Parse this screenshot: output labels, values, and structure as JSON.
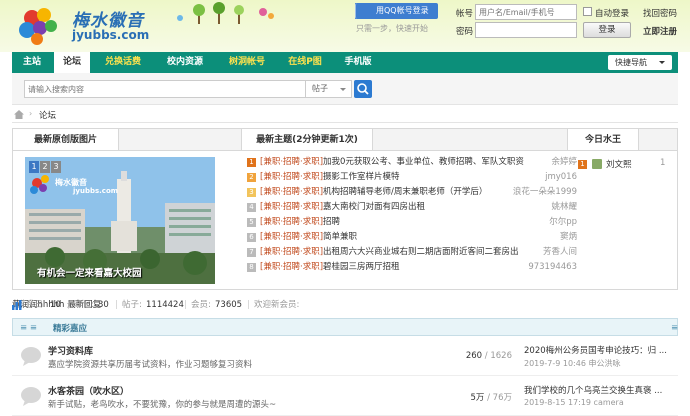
{
  "header": {
    "logo_cn": "梅水徽音",
    "logo_en": "jyubbs.com",
    "qq_login": "用QQ帐号登录",
    "qq_hint": "只需一步，快速开始",
    "account_label": "帐号",
    "account_placeholder": "用户名/Email/手机号",
    "password_label": "密码",
    "auto_login": "自动登录",
    "find_password": "找回密码",
    "login_button": "登录",
    "register": "立即注册"
  },
  "nav": {
    "items": [
      "主站",
      "论坛",
      "兑换话费",
      "校内资源",
      "树洞帐号",
      "在线P图",
      "手机版"
    ],
    "quick_nav": "快捷导航"
  },
  "search": {
    "placeholder": "请输入搜索内容",
    "type": "帖子"
  },
  "breadcrumb": {
    "current": "论坛"
  },
  "portal": {
    "photos_title": "最新原创版图片",
    "slide_nums": [
      "1",
      "2",
      "3"
    ],
    "slide_caption": "有机会一定来看嘉大校园",
    "slide_logo_en": "jyubbs.com",
    "slide_logo_cn": "梅水徽音",
    "threads_title": "最新主题(2分钟更新1次)",
    "threads": [
      {
        "n": "1",
        "tag": "[兼职·招聘·求职]",
        "title": "加我0元获取公考、事业单位、教师招聘、军队文职资",
        "author": "余婷婷"
      },
      {
        "n": "2",
        "tag": "[兼职·招聘·求职]",
        "title": "摄影工作室样片模特",
        "author": "jmy016"
      },
      {
        "n": "3",
        "tag": "[兼职·招聘·求职]",
        "title": "机构招聘辅导老师/周末兼职老师（开学后）",
        "author": "浪花一朵朵1999"
      },
      {
        "n": "4",
        "tag": "[兼职·招聘·求职]",
        "title": "嘉大南校门对面有四房出租",
        "author": "姚林耀"
      },
      {
        "n": "5",
        "tag": "[兼职·招聘·求职]",
        "title": "招聘",
        "author": "尔尔pp"
      },
      {
        "n": "6",
        "tag": "[兼职·招聘·求职]",
        "title": "简单兼职",
        "author": "窦炳"
      },
      {
        "n": "7",
        "tag": "[兼职·招聘·求职]",
        "title": "出租周六大兴商业城右则二期店面附近客间二套房出",
        "author": "芳香人间"
      },
      {
        "n": "8",
        "tag": "[兼职·招聘·求职]",
        "title": "碧桂园三房两厅招租",
        "author": "973194463"
      }
    ],
    "king_title": "今日水王",
    "king": {
      "rank": "1",
      "name": "刘文熙",
      "count": "1"
    }
  },
  "stats": {
    "today_label": "今日:",
    "today": "10",
    "yesterday_label": "昨日:",
    "yesterday": "30",
    "posts_label": "帖子:",
    "posts": "1114424",
    "members_label": "会员:",
    "members": "73605",
    "welcome": "欢迎新会员:",
    "new_member": "黄润润hhhhh",
    "latest_replies": "最新回复"
  },
  "category": {
    "lines": "≡ ≡",
    "title": "精彩嘉应",
    "collapse": "≡",
    "forums": [
      {
        "name": "学习资料库",
        "desc": "嘉应学院资源共享历届考试资料，作业习题够复习资料",
        "topics": "260",
        "posts": "1626",
        "last": "2020梅州公务员国考申论技巧：归 ...",
        "meta": "2019-7-9 10:46 申公洪咏"
      },
      {
        "name": "水客茶园（吹水区）",
        "desc": "新手试贴，老鸟吹水，不要犹豫，你的参与就是周遭的源头~",
        "topics": "5万",
        "posts": "76万",
        "last": "我们学校的几个乌亮兰交换生真褒 ...",
        "meta": "2019-8-15 17:19 camera"
      }
    ]
  },
  "colors": {
    "nav": "#0c8f7a",
    "accent": "#2c7ad1",
    "tag": "#c24c20"
  }
}
